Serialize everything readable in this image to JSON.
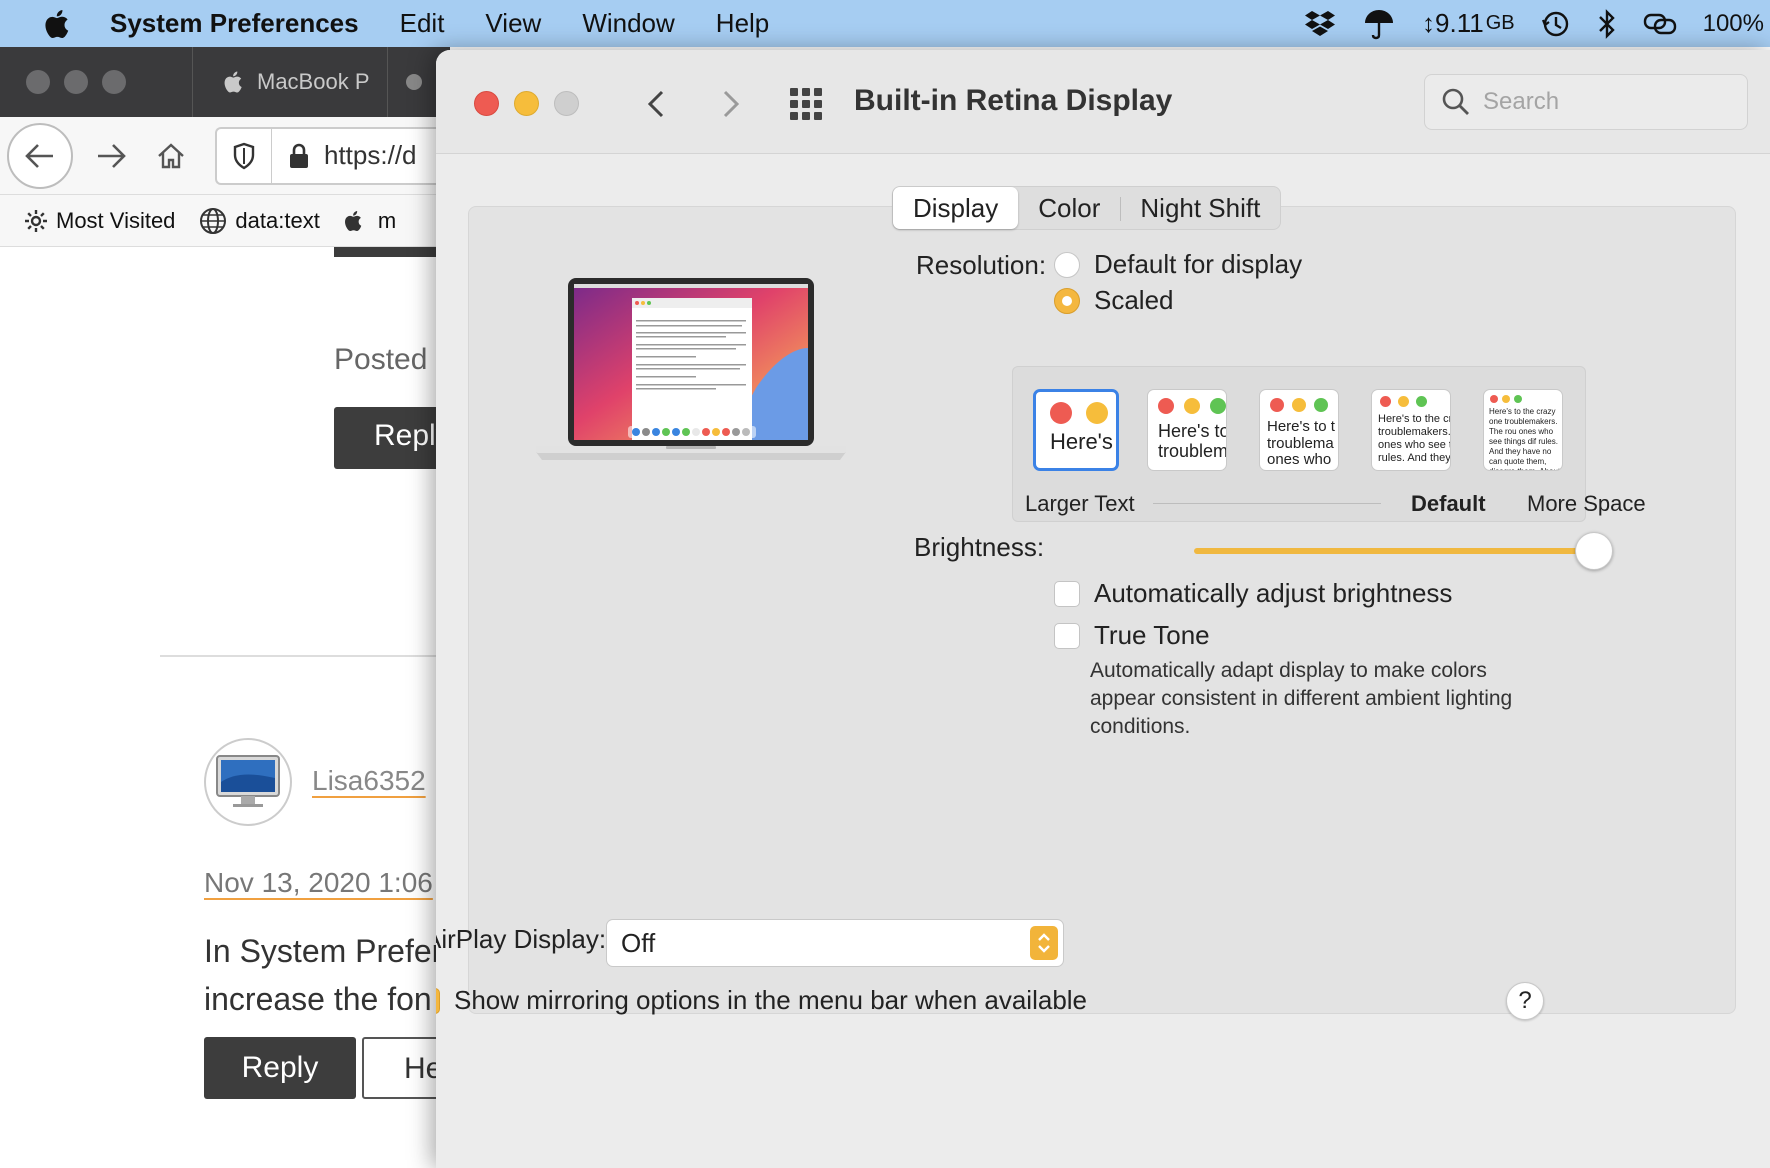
{
  "menubar": {
    "app_name": "System Preferences",
    "menus": [
      "Edit",
      "View",
      "Window",
      "Help"
    ],
    "disk_free": "9.11",
    "disk_unit": "GB",
    "battery": "100%"
  },
  "browser": {
    "tab_label": "MacBook P",
    "url": "https://d",
    "bookmarks": [
      "Most Visited",
      "data:text",
      "m"
    ],
    "posted": "Posted o",
    "reply_top": "Reply",
    "username": "Lisa6352",
    "date": "Nov 13, 2020 1:06",
    "answer_line1": "In System Prefer",
    "answer_line2": "increase the fon",
    "reply_label": "Reply",
    "helpful_label": "He"
  },
  "prefs": {
    "title": "Built-in Retina Display",
    "search_placeholder": "Search",
    "tabs": [
      "Display",
      "Color",
      "Night Shift"
    ],
    "resolution": {
      "label": "Resolution:",
      "options": [
        "Default for display",
        "Scaled"
      ],
      "selected": "Scaled"
    },
    "scale_options": [
      {
        "sample": "Here's"
      },
      {
        "sample": "Here's to troublem"
      },
      {
        "sample": "Here's to t troublema ones who"
      },
      {
        "sample": "Here's to the cr troublemakers. ones who see t rules. And they"
      },
      {
        "sample": "Here's to the crazy one troublemakers. The rou ones who see things dif rules. And they have no can quote them, disagre them. About the only th Because they change th"
      }
    ],
    "scale_labels": {
      "left": "Larger Text",
      "default": "Default",
      "right": "More Space"
    },
    "brightness": {
      "label": "Brightness:",
      "level": 0.97
    },
    "auto_brightness_label": "Automatically adjust brightness",
    "true_tone_label": "True Tone",
    "true_tone_desc": "Automatically adapt display to make colors appear consistent in different ambient lighting conditions.",
    "airplay": {
      "label": "AirPlay Display:",
      "value": "Off"
    },
    "mirroring_label": "Show mirroring options in the menu bar when available",
    "help": "?"
  },
  "colors": {
    "accent": "#f4b73f",
    "selection": "#3b82e6",
    "menubar": "#a6cdf2"
  }
}
